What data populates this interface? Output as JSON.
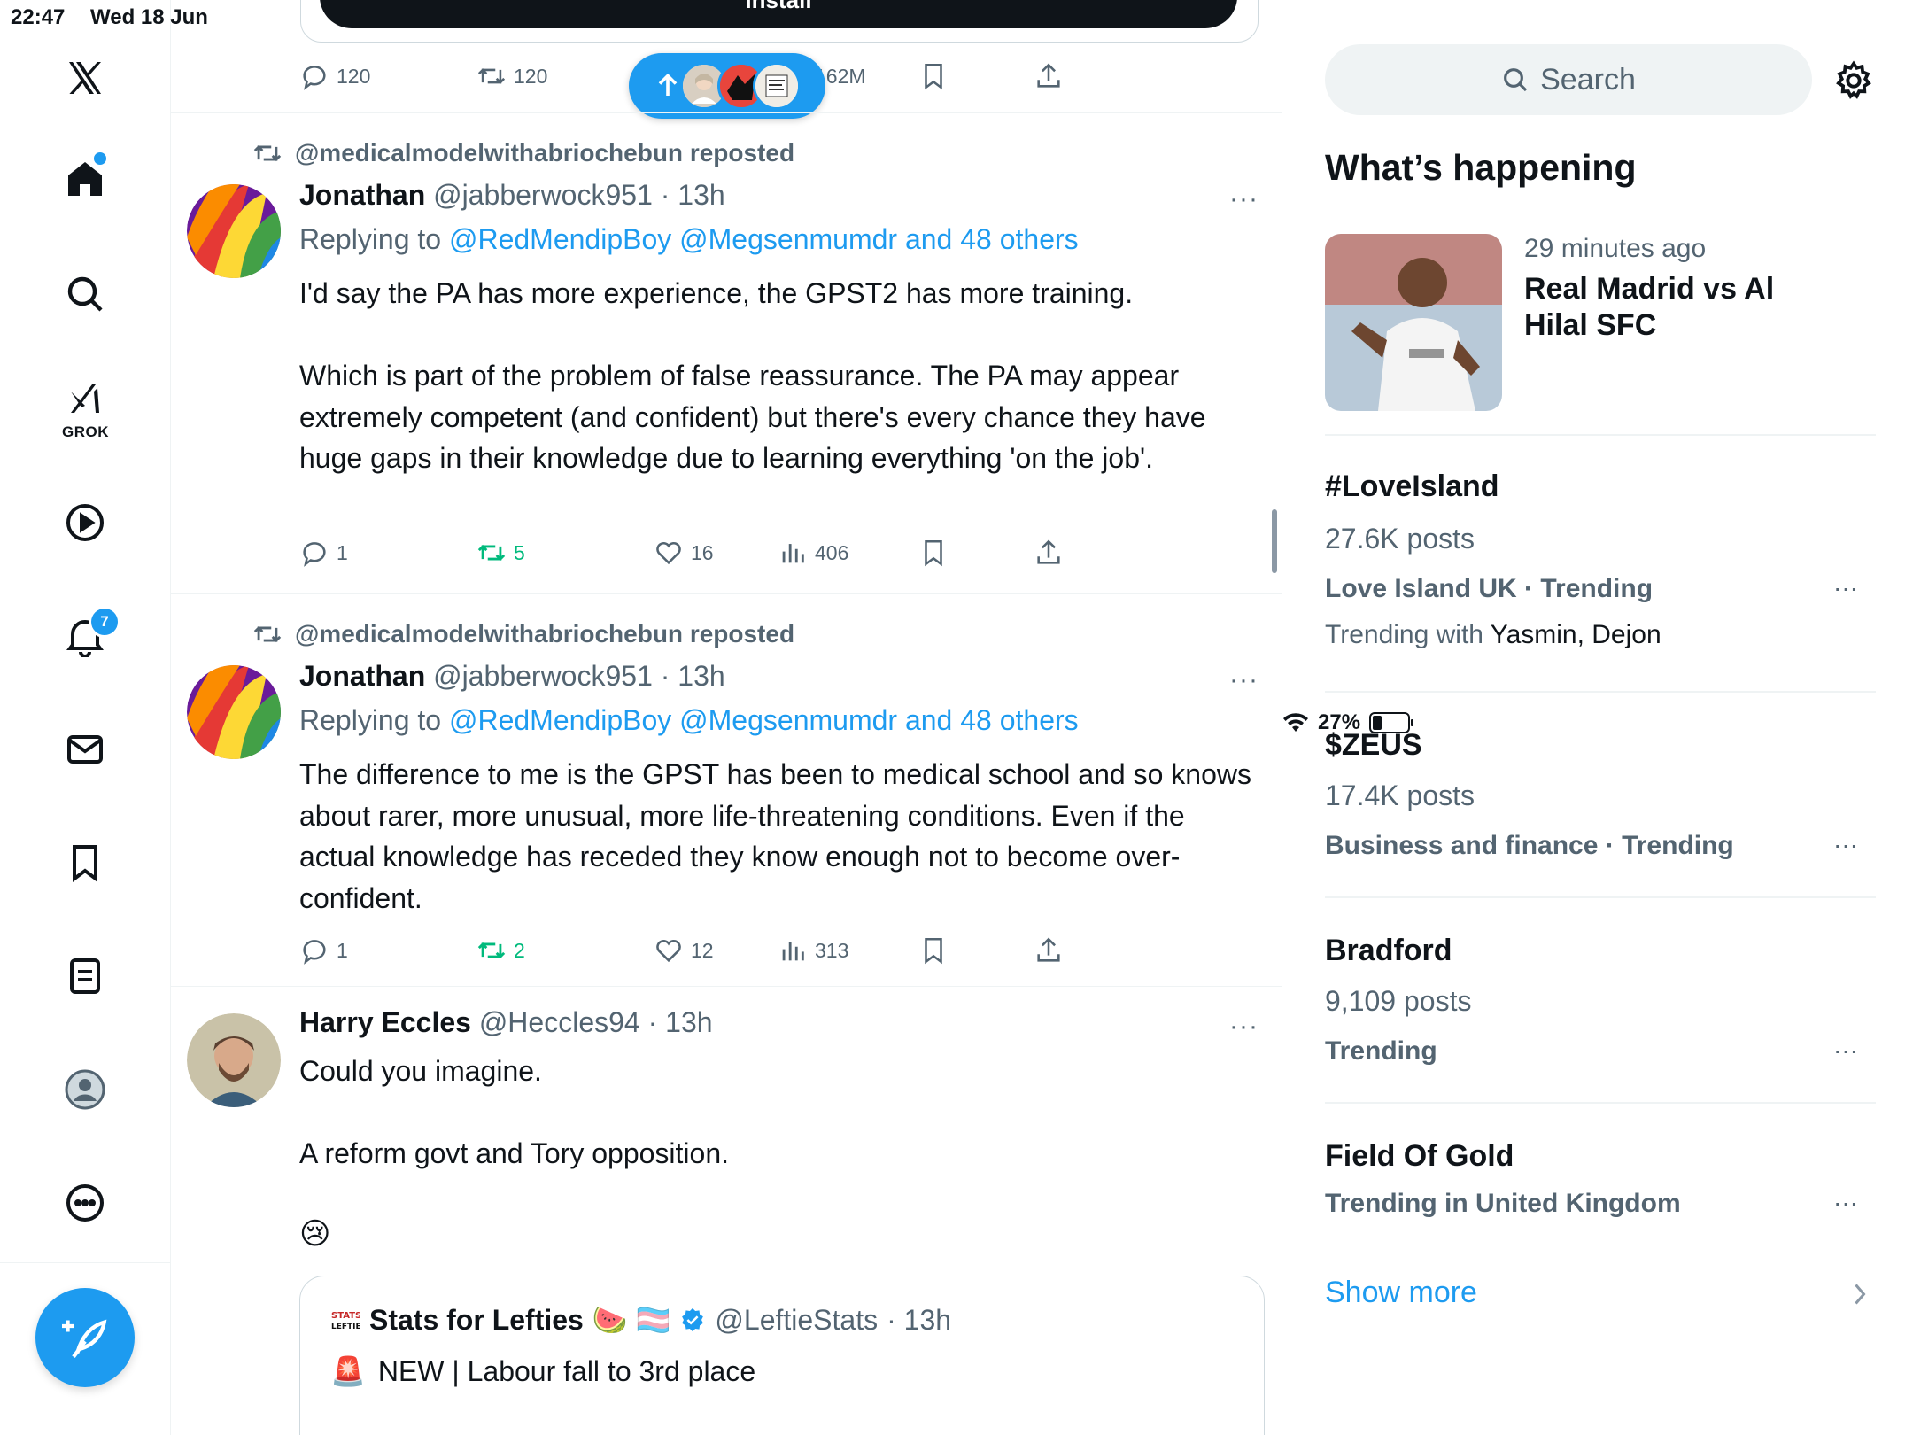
{
  "status": {
    "time": "22:47",
    "date": "Wed 18 Jun",
    "battery": "27%",
    "battery_level": 0.27
  },
  "nav": {
    "grok_label": "GROK",
    "notifications_badge": "7"
  },
  "feed": {
    "install_label": "Install",
    "top_actions": {
      "replies": "120",
      "reposts": "120",
      "views": "162M"
    },
    "posts": [
      {
        "repost_by": "@medicalmodelwithabriochebun reposted",
        "name": "Jonathan",
        "handle": "@jabberwock951",
        "time": "· 13h",
        "replying_prefix": "Replying to",
        "replying_links": "@RedMendipBoy @Megsenmumdr and 48 others",
        "text": "I'd say the PA has more experience, the GPST2 has more training.\n\nWhich is part of the problem of false reassurance. The PA may appear extremely competent (and confident) but there's every chance they have huge gaps in their knowledge due to learning everything 'on the job'.",
        "replies": "1",
        "reposts": "5",
        "likes": "16",
        "views": "406"
      },
      {
        "repost_by": "@medicalmodelwithabriochebun reposted",
        "name": "Jonathan",
        "handle": "@jabberwock951",
        "time": "· 13h",
        "replying_prefix": "Replying to",
        "replying_links": "@RedMendipBoy @Megsenmumdr and 48 others",
        "text": "The difference to me is the GPST has been to medical school and so knows about rarer, more unusual, more life-threatening conditions. Even if the actual knowledge has receded they know enough not to become over-confident.",
        "replies": "1",
        "reposts": "2",
        "likes": "12",
        "views": "313"
      },
      {
        "name": "Harry Eccles",
        "handle": "@Heccles94",
        "time": "· 13h",
        "text": "Could you imagine.\n\nA reform govt and Tory opposition.",
        "emoji": "😢",
        "quote": {
          "name": "Stats for Lefties",
          "name_emojis": "🍉 🏳️‍⚧️",
          "handle": "@LeftieStats",
          "time": "· 13h",
          "siren": "🚨",
          "text": "NEW | Labour fall to 3rd place"
        }
      }
    ]
  },
  "sidebar": {
    "search_placeholder": "Search",
    "title": "What’s happening",
    "news": {
      "time": "29 minutes ago",
      "title": "Real Madrid vs Al Hilal SFC"
    },
    "trends": [
      {
        "title": "#LoveIsland",
        "posts": "27.6K posts",
        "meta": "Love Island UK · Trending",
        "with_prefix": "Trending with",
        "with_names": "Yasmin, Dejon"
      },
      {
        "title": "$ZEUS",
        "posts": "17.4K posts",
        "meta": "Business and finance · Trending"
      },
      {
        "title": "Bradford",
        "posts": "9,109 posts",
        "meta": "Trending"
      },
      {
        "title": "Field Of Gold",
        "meta": "Trending in United Kingdom"
      }
    ],
    "show_more": "Show more"
  },
  "colors": {
    "accent": "#1d9bf0",
    "repost_green": "#00ba7c",
    "muted": "#536471",
    "text": "#0f1419"
  }
}
